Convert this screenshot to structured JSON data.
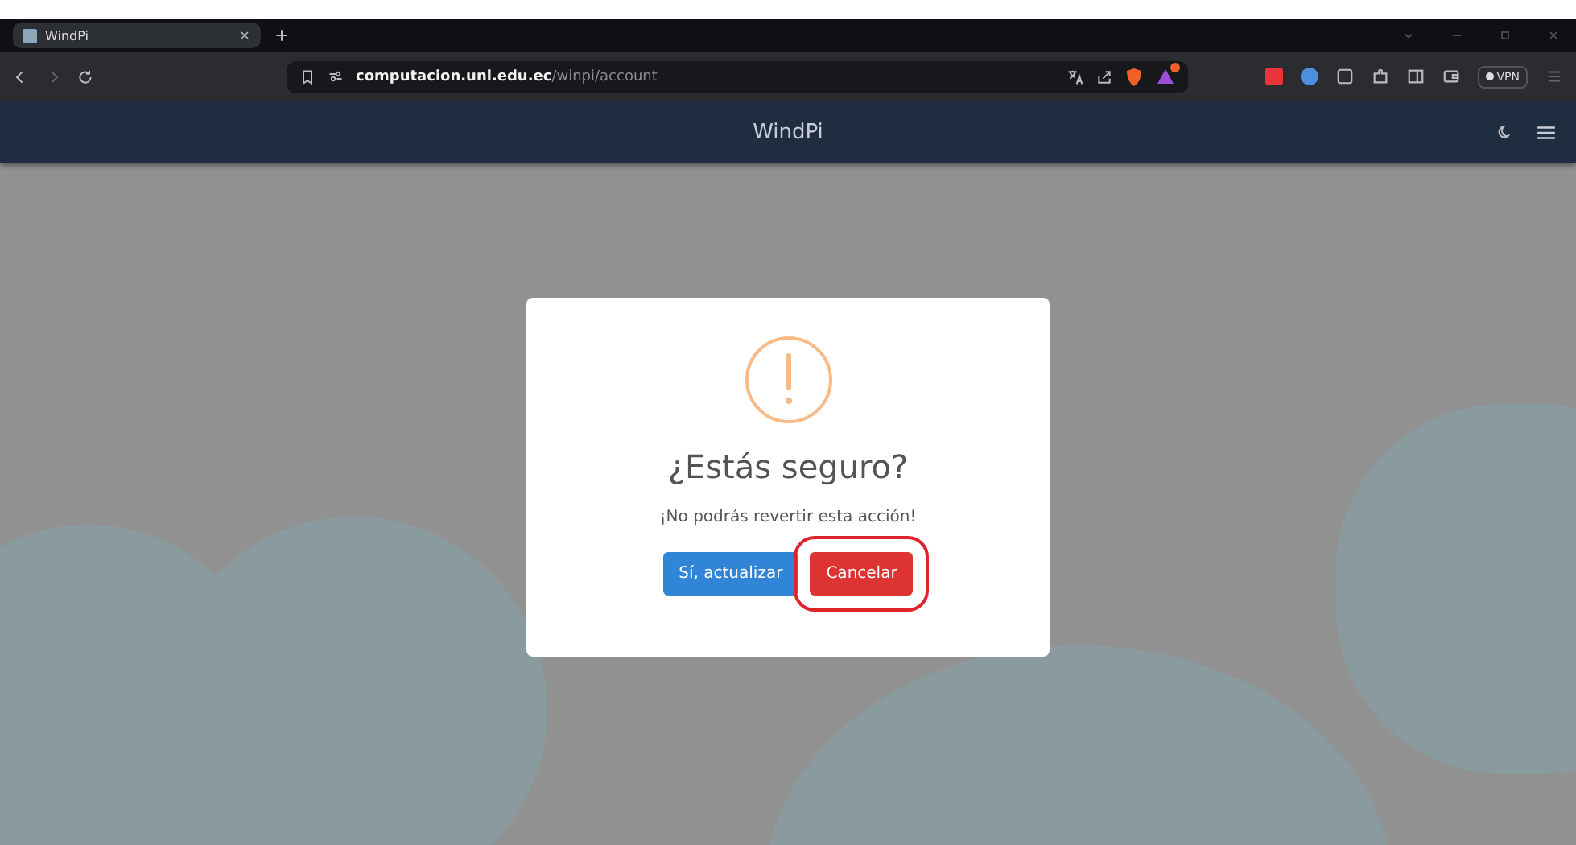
{
  "browser": {
    "tab": {
      "title": "WindPi"
    },
    "url": "**computacion.unl.edu.ec**/winpi/account",
    "vpn_label": "VPN",
    "notification_badge": true
  },
  "app_header": {
    "title": "WindPi"
  },
  "dialog": {
    "title": "¿Estás seguro?",
    "message": "¡No podrás revertir esta acción!",
    "buttons": [
      {
        "label": "Sí, actualizar",
        "kind": "confirm",
        "highlighted": false
      },
      {
        "label": "Cancelar",
        "kind": "cancel",
        "highlighted": true
      }
    ]
  }
}
